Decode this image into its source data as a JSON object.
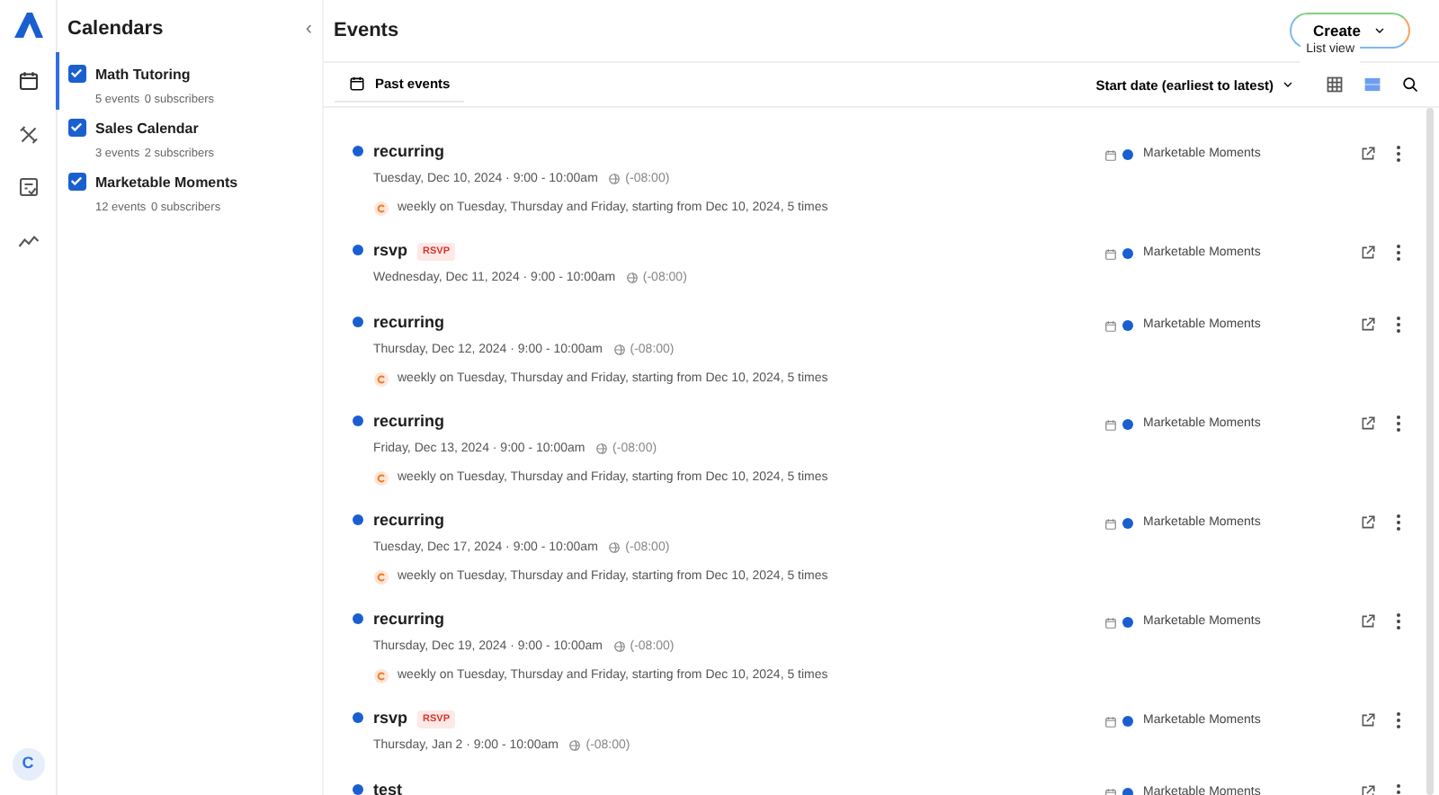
{
  "sidebar": {
    "items": [
      {
        "kind": "calendar",
        "selected": true
      },
      {
        "kind": "tools",
        "selected": false
      },
      {
        "kind": "checklist",
        "selected": false
      },
      {
        "kind": "chart",
        "selected": false
      }
    ],
    "avatar": "C"
  },
  "calendars": {
    "title": "Calendars",
    "collapse": "‹",
    "items": [
      {
        "name": "Math Tutoring",
        "events": "5 events",
        "subscribers": "0 subscribers",
        "checked": true
      },
      {
        "name": "Sales Calendar",
        "events": "3 events",
        "subscribers": "2 subscribers",
        "checked": true
      },
      {
        "name": "Marketable Moments",
        "events": "12 events",
        "subscribers": "0 subscribers",
        "checked": true
      }
    ]
  },
  "header": {
    "title": "Events",
    "create": "Create",
    "tooltip": "List view"
  },
  "toolbar": {
    "past": "Past events",
    "sort": "Start date (earliest to latest)",
    "views": [
      {
        "kind": "grid",
        "selected": false
      },
      {
        "kind": "list",
        "selected": true
      }
    ]
  },
  "events": [
    {
      "title": "recurring",
      "when": "Tuesday, Dec 10, 2024 · 9:00 - 10:00am",
      "tz": "(-08:00)",
      "repeat": "weekly on Tuesday, Thursday and Friday, starting from Dec 10, 2024, 5 times",
      "calendar": "Marketable Moments",
      "color": "#1a5fd0"
    },
    {
      "title": "rsvp",
      "badge": "RSVP",
      "when": "Wednesday, Dec 11, 2024 · 9:00 - 10:00am",
      "tz": "(-08:00)",
      "calendar": "Marketable Moments",
      "color": "#1a5fd0"
    },
    {
      "title": "recurring",
      "when": "Thursday, Dec 12, 2024 · 9:00 - 10:00am",
      "tz": "(-08:00)",
      "repeat": "weekly on Tuesday, Thursday and Friday, starting from Dec 10, 2024, 5 times",
      "calendar": "Marketable Moments",
      "color": "#1a5fd0"
    },
    {
      "title": "recurring",
      "when": "Friday, Dec 13, 2024 · 9:00 - 10:00am",
      "tz": "(-08:00)",
      "repeat": "weekly on Tuesday, Thursday and Friday, starting from Dec 10, 2024, 5 times",
      "calendar": "Marketable Moments",
      "color": "#1a5fd0"
    },
    {
      "title": "recurring",
      "when": "Tuesday, Dec 17, 2024 · 9:00 - 10:00am",
      "tz": "(-08:00)",
      "repeat": "weekly on Tuesday, Thursday and Friday, starting from Dec 10, 2024, 5 times",
      "calendar": "Marketable Moments",
      "color": "#1a5fd0"
    },
    {
      "title": "recurring",
      "when": "Thursday, Dec 19, 2024 · 9:00 - 10:00am",
      "tz": "(-08:00)",
      "repeat": "weekly on Tuesday, Thursday and Friday, starting from Dec 10, 2024, 5 times",
      "calendar": "Marketable Moments",
      "color": "#1a5fd0"
    },
    {
      "title": "rsvp",
      "badge": "RSVP",
      "when": "Thursday, Jan 2 · 9:00 - 10:00am",
      "tz": "(-08:00)",
      "calendar": "Marketable Moments",
      "color": "#1a5fd0"
    },
    {
      "title": "test",
      "calendar": "Marketable Moments",
      "color": "#1a5fd0"
    }
  ]
}
